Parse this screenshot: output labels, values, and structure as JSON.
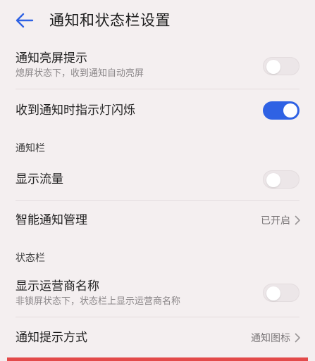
{
  "header": {
    "title": "通知和状态栏设置",
    "back_icon": "arrow-left-icon",
    "accent": "#2f62e4"
  },
  "settings": {
    "screen_wake": {
      "title": "通知亮屏提示",
      "subtitle": "熄屏状态下，收到通知自动亮屏",
      "enabled": false
    },
    "indicator_light": {
      "title": "收到通知时指示灯闪烁",
      "enabled": true
    }
  },
  "sections": {
    "notification_bar": {
      "label": "通知栏",
      "show_traffic": {
        "title": "显示流量",
        "enabled": false
      },
      "smart_management": {
        "title": "智能通知管理",
        "value": "已开启"
      }
    },
    "status_bar": {
      "label": "状态栏",
      "show_carrier": {
        "title": "显示运营商名称",
        "subtitle": "非锁屏状态下，状态栏上显示运营商名称",
        "enabled": false
      },
      "notify_method": {
        "title": "通知提示方式",
        "value": "通知图标"
      }
    }
  },
  "colors": {
    "toggle_on": "#2f62e4",
    "toggle_off": "#ece6e8",
    "background": "#f4eff0"
  }
}
